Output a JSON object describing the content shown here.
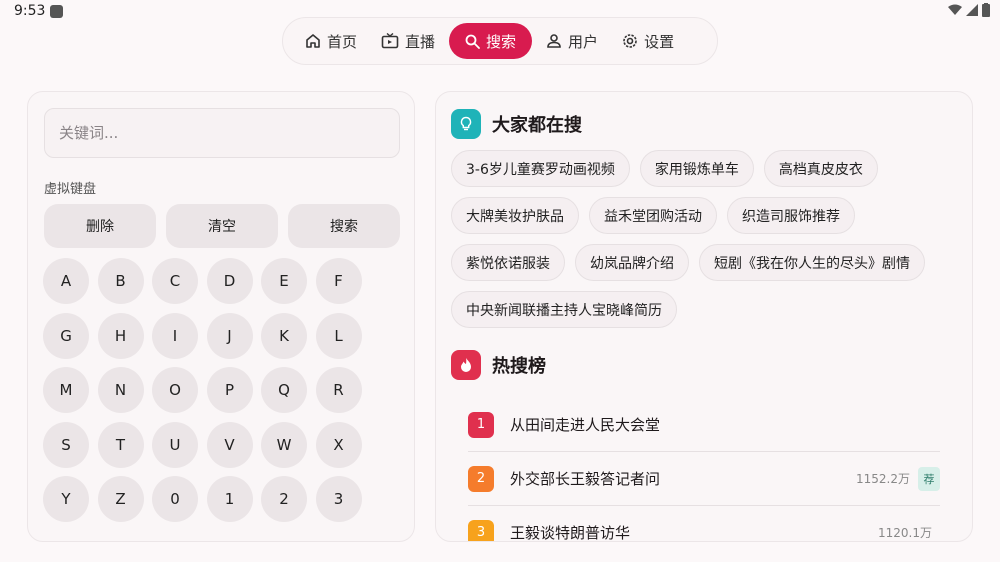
{
  "status_bar": {
    "time": "9:53"
  },
  "nav": {
    "items": [
      {
        "label": "首页",
        "icon": "home-icon"
      },
      {
        "label": "直播",
        "icon": "live-tv-icon"
      },
      {
        "label": "搜索",
        "icon": "search-icon"
      },
      {
        "label": "用户",
        "icon": "user-icon"
      },
      {
        "label": "设置",
        "icon": "gear-icon"
      }
    ],
    "active": "搜索"
  },
  "search": {
    "placeholder": "关键词...",
    "keyboard_label": "虚拟键盘",
    "actions": [
      "删除",
      "清空",
      "搜索"
    ],
    "keys": [
      "A",
      "B",
      "C",
      "D",
      "E",
      "F",
      "G",
      "H",
      "I",
      "J",
      "K",
      "L",
      "M",
      "N",
      "O",
      "P",
      "Q",
      "R",
      "S",
      "T",
      "U",
      "V",
      "W",
      "X",
      "Y",
      "Z",
      "0",
      "1",
      "2",
      "3"
    ]
  },
  "popular": {
    "title": "大家都在搜",
    "tags": [
      "3-6岁儿童赛罗动画视频",
      "家用锻炼单车",
      "高档真皮皮衣",
      "大牌美妆护肤品",
      "益禾堂团购活动",
      "织造司服饰推荐",
      "紫悦依诺服装",
      "幼岚品牌介绍",
      "短剧《我在你人生的尽头》剧情",
      "中央新闻联播主持人宝晓峰简历"
    ]
  },
  "hot": {
    "title": "热搜榜",
    "items": [
      {
        "rank": "1",
        "title": "从田间走进人民大会堂",
        "count": "",
        "badge": ""
      },
      {
        "rank": "2",
        "title": "外交部长王毅答记者问",
        "count": "1152.2万",
        "badge": "荐"
      },
      {
        "rank": "3",
        "title": "王毅谈特朗普访华",
        "count": "1120.1万",
        "badge": ""
      }
    ]
  },
  "colors": {
    "accent": "#d81b4f",
    "teal": "#1fb3b8",
    "rank1": "#e0304e",
    "rank2": "#f57c2c",
    "rank3": "#f7a21c"
  }
}
